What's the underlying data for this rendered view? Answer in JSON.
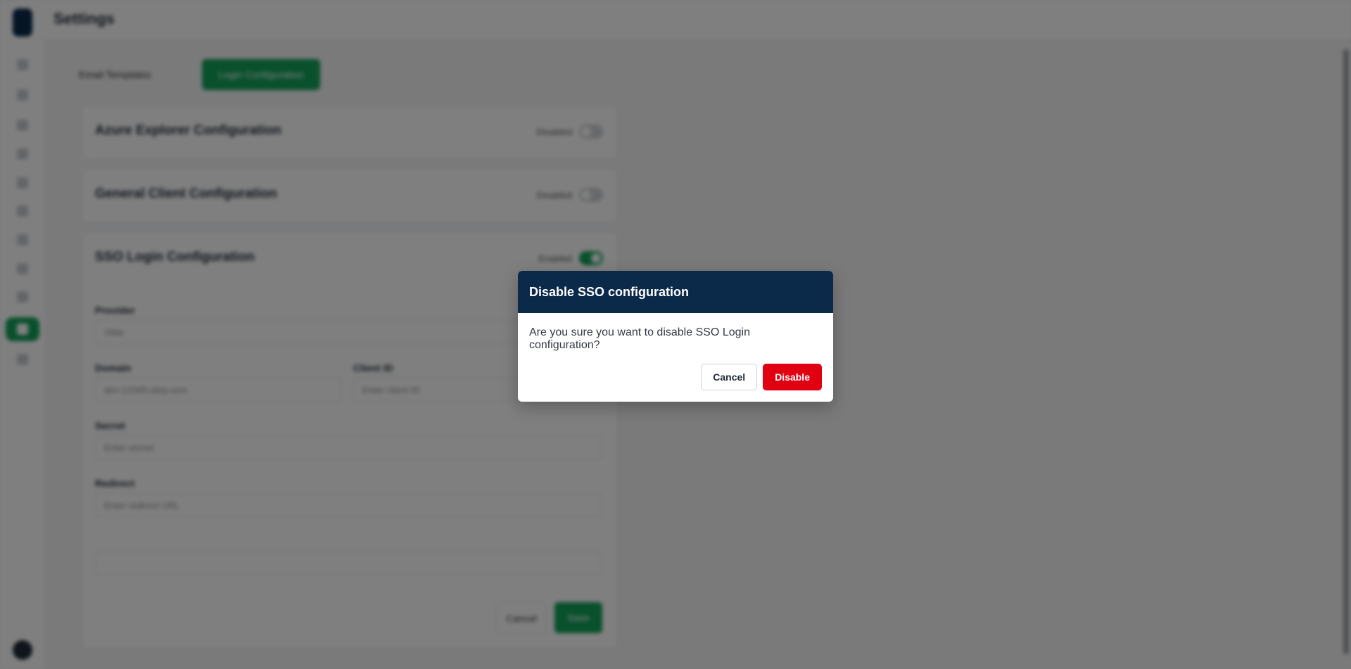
{
  "app": {
    "page_title": "Settings"
  },
  "background": {
    "tab_plain_label": "Email Templates",
    "tab_active_label": "Login Configuration",
    "panels": [
      {
        "title": "Azure Explorer Configuration",
        "status": "Disabled"
      },
      {
        "title": "General Client Configuration",
        "status": "Disabled"
      },
      {
        "title": "SSO Login Configuration",
        "status": "Enabled"
      }
    ],
    "fields": {
      "provider_label": "Provider",
      "provider_value": "Okta",
      "domain_label": "Domain",
      "domain_value": "dev-12345.okta.com",
      "client_label": "Client ID",
      "client_placeholder": "Enter client ID",
      "secret_label": "Secret",
      "secret_placeholder": "Enter secret",
      "redirect_label": "Redirect",
      "redirect_placeholder": "Enter redirect URL"
    },
    "cancel_label": "Cancel",
    "save_label": "Save"
  },
  "modal": {
    "title": "Disable SSO configuration",
    "message": "Are you sure you want to disable SSO Login configuration?",
    "cancel_label": "Cancel",
    "confirm_label": "Disable"
  },
  "colors": {
    "modal_header": "#0b2a4a",
    "danger": "#e00012",
    "accent": "#12a15a"
  },
  "icons": {
    "logo": "app-logo-icon",
    "nav": [
      "home-icon",
      "users-icon",
      "database-icon",
      "reports-icon",
      "chart-icon",
      "list-icon",
      "settings-icon",
      "folder-icon",
      "calendar-icon",
      "login-config-icon",
      "more-icon"
    ]
  }
}
